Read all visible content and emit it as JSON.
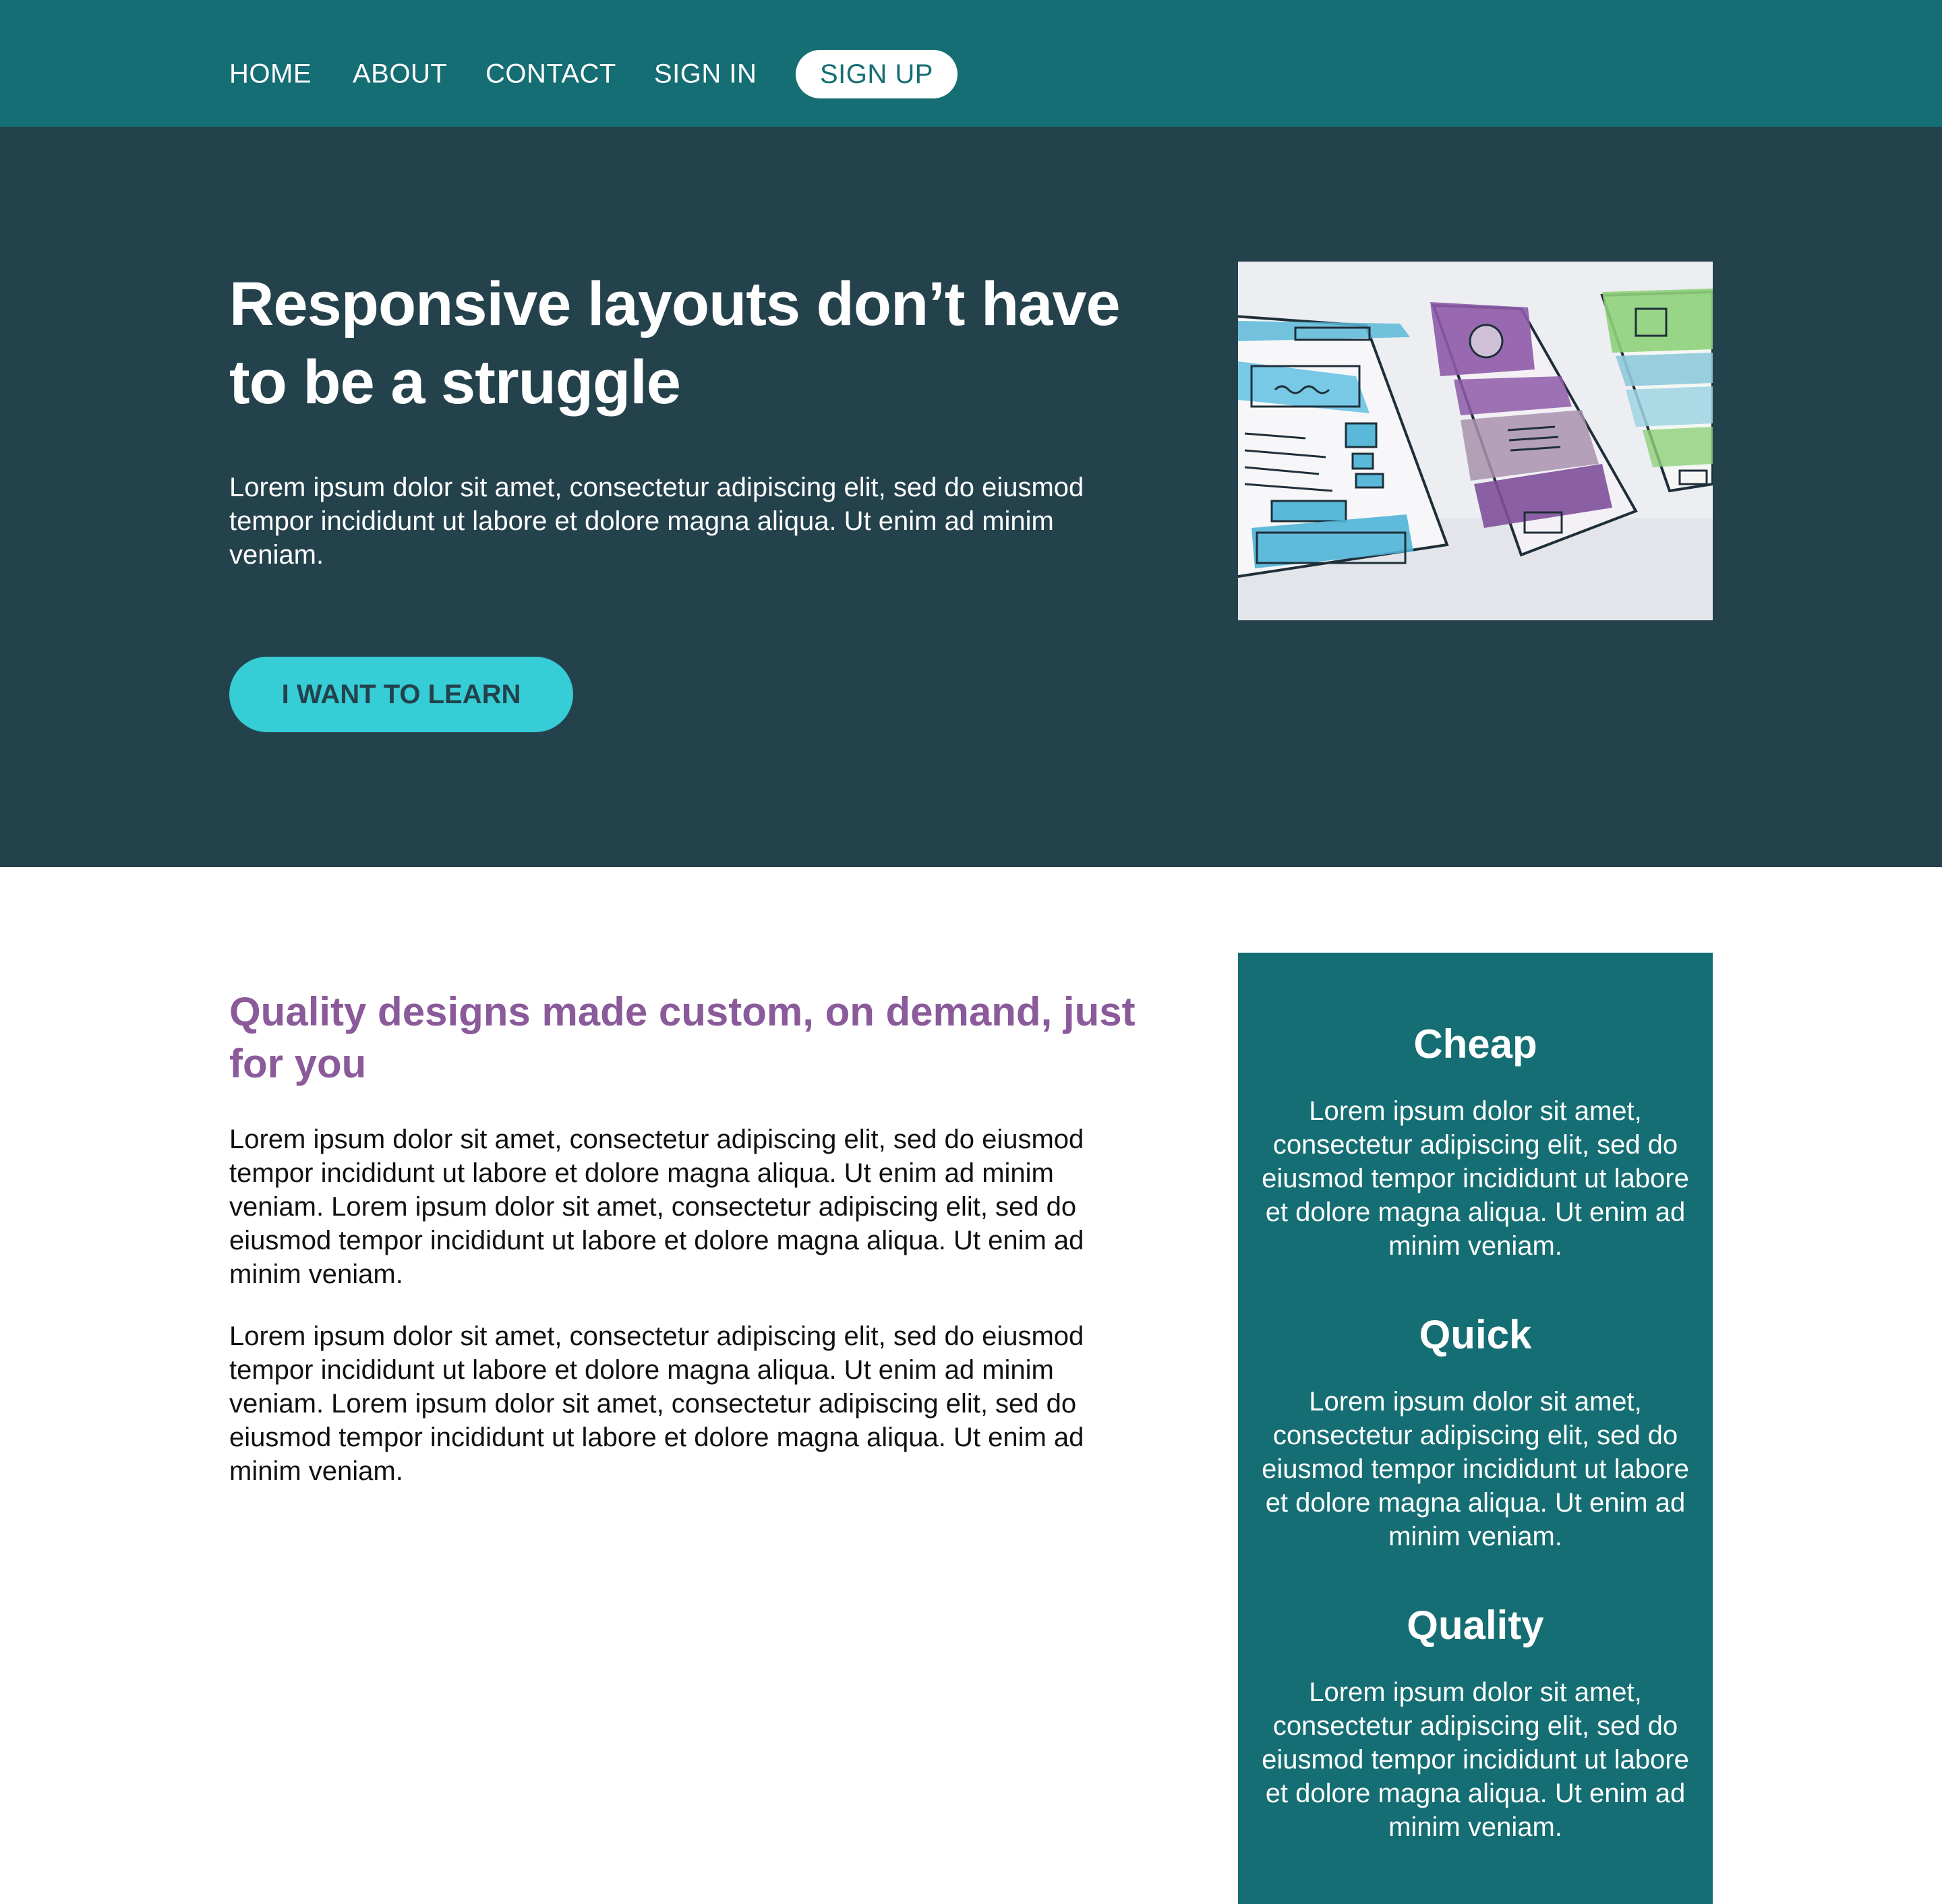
{
  "nav": {
    "home": "HOME",
    "about": "ABOUT",
    "contact": "CONTACT",
    "sign_in": "SIGN IN",
    "sign_up": "SIGN UP"
  },
  "hero": {
    "title": "Responsive layouts don’t have to be a struggle",
    "text": "Lorem ipsum dolor sit amet, consectetur adipiscing elit, sed do eiusmod tempor incididunt ut labore et dolore magna aliqua. Ut enim ad minim veniam.",
    "button": "I WANT TO LEARN",
    "image_icon": "wireframe-sketch-illustration"
  },
  "main": {
    "heading": "Quality designs made custom, on demand, just for you",
    "paragraphs": [
      "Lorem ipsum dolor sit amet, consectetur adipiscing elit, sed do eiusmod tempor incididunt ut labore et dolore magna aliqua. Ut enim ad minim veniam. Lorem ipsum dolor sit amet, consectetur adipiscing elit, sed do eiusmod tempor incididunt ut labore et dolore magna aliqua. Ut enim ad minim veniam.",
      "Lorem ipsum dolor sit amet, consectetur adipiscing elit, sed do eiusmod tempor incididunt ut labore et dolore magna aliqua. Ut enim ad minim veniam. Lorem ipsum dolor sit amet, consectetur adipiscing elit, sed do eiusmod tempor incididunt ut labore et dolore magna aliqua. Ut enim ad minim veniam."
    ]
  },
  "sidebar": {
    "features": [
      {
        "title": "Cheap",
        "text": "Lorem ipsum dolor sit amet, consectetur adipiscing elit, sed do eiusmod tempor incididunt ut labore et dolore magna aliqua. Ut enim ad minim veniam."
      },
      {
        "title": "Quick",
        "text": "Lorem ipsum dolor sit amet, consectetur adipiscing elit, sed do eiusmod tempor incididunt ut labore et dolore magna aliqua. Ut enim ad minim veniam."
      },
      {
        "title": "Quality",
        "text": "Lorem ipsum dolor sit amet, consectetur adipiscing elit, sed do eiusmod tempor incididunt ut labore et dolore magna aliqua. Ut enim ad minim veniam."
      }
    ]
  },
  "colors": {
    "nav_bg": "#156e73",
    "hero_bg": "#24424c",
    "accent_button": "#36cdd6",
    "heading_purple": "#8a5a9a",
    "sidebar_bg": "#156e73"
  }
}
